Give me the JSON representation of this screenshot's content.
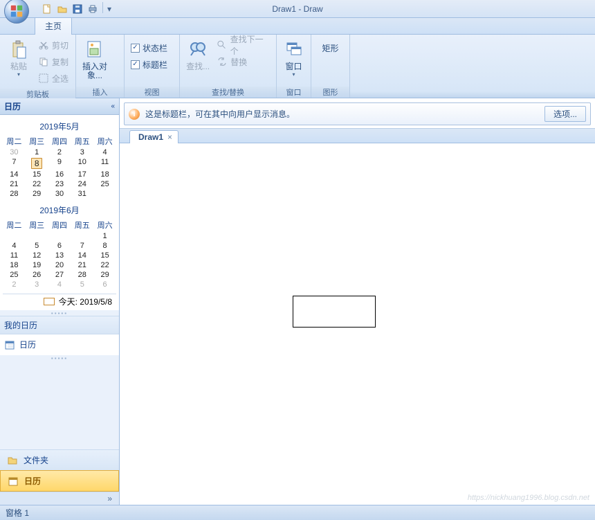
{
  "app": {
    "title": "Draw1 - Draw"
  },
  "qat": {
    "items": [
      "new",
      "open",
      "save",
      "print"
    ]
  },
  "tabs": {
    "home": "主页"
  },
  "ribbon": {
    "clipboard": {
      "label": "剪贴板",
      "paste": "粘贴",
      "cut": "剪切",
      "copy": "复制",
      "selectall": "全选"
    },
    "insert": {
      "label": "插入",
      "object": "插入对象..."
    },
    "view": {
      "label": "视图",
      "statusbar": "状态栏",
      "titlebar": "标题栏"
    },
    "findreplace": {
      "label": "查找/替换",
      "find": "查找...",
      "findnext": "查找下一个",
      "replace": "替换"
    },
    "window": {
      "label": "窗口",
      "window": "窗口"
    },
    "shapes": {
      "label": "图形",
      "rect": "矩形"
    }
  },
  "sidebar": {
    "title": "日历",
    "month1": {
      "title": "2019年5月",
      "dow": [
        "周二",
        "周三",
        "周四",
        "周五",
        "周六"
      ],
      "cells": [
        {
          "d": "30",
          "o": true
        },
        {
          "d": "1"
        },
        {
          "d": "2"
        },
        {
          "d": "3"
        },
        {
          "d": "4"
        },
        {
          "d": "7"
        },
        {
          "d": "8",
          "t": true
        },
        {
          "d": "9"
        },
        {
          "d": "10"
        },
        {
          "d": "11"
        },
        {
          "d": "14"
        },
        {
          "d": "15"
        },
        {
          "d": "16"
        },
        {
          "d": "17"
        },
        {
          "d": "18"
        },
        {
          "d": "21"
        },
        {
          "d": "22"
        },
        {
          "d": "23"
        },
        {
          "d": "24"
        },
        {
          "d": "25"
        },
        {
          "d": "28"
        },
        {
          "d": "29"
        },
        {
          "d": "30"
        },
        {
          "d": "31"
        },
        {
          "d": ""
        }
      ]
    },
    "month2": {
      "title": "2019年6月",
      "dow": [
        "周二",
        "周三",
        "周四",
        "周五",
        "周六"
      ],
      "cells": [
        {
          "d": ""
        },
        {
          "d": ""
        },
        {
          "d": ""
        },
        {
          "d": ""
        },
        {
          "d": "1"
        },
        {
          "d": "4"
        },
        {
          "d": "5"
        },
        {
          "d": "6"
        },
        {
          "d": "7"
        },
        {
          "d": "8"
        },
        {
          "d": "11"
        },
        {
          "d": "12"
        },
        {
          "d": "13"
        },
        {
          "d": "14"
        },
        {
          "d": "15"
        },
        {
          "d": "18"
        },
        {
          "d": "19"
        },
        {
          "d": "20"
        },
        {
          "d": "21"
        },
        {
          "d": "22"
        },
        {
          "d": "25"
        },
        {
          "d": "26"
        },
        {
          "d": "27"
        },
        {
          "d": "28"
        },
        {
          "d": "29"
        },
        {
          "d": "2",
          "o": true
        },
        {
          "d": "3",
          "o": true
        },
        {
          "d": "4",
          "o": true
        },
        {
          "d": "5",
          "o": true
        },
        {
          "d": "6",
          "o": true
        }
      ]
    },
    "today": "今天: 2019/5/8",
    "mycal": "我的日历",
    "cal_item": "日历",
    "folders": "文件夹",
    "nav_cal": "日历"
  },
  "messagebar": {
    "text": "这是标题栏，可在其中向用户显示消息。",
    "options": "选项..."
  },
  "doc": {
    "tab": "Draw1"
  },
  "status": {
    "text": "窗格 1"
  },
  "watermark": "https://nickhuang1996.blog.csdn.net"
}
